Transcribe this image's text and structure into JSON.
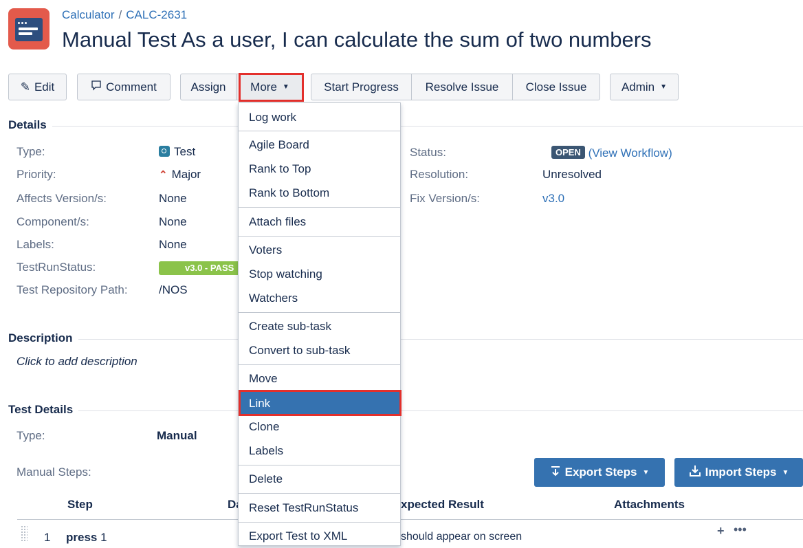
{
  "header": {
    "project": "Calculator",
    "separator": "/",
    "issue_key": "CALC-2631",
    "summary": "Manual Test As a user, I can calculate the sum of two numbers"
  },
  "toolbar": {
    "edit": "Edit",
    "comment": "Comment",
    "assign": "Assign",
    "more": "More",
    "start_progress": "Start Progress",
    "resolve_issue": "Resolve Issue",
    "close_issue": "Close Issue",
    "admin": "Admin"
  },
  "details": {
    "title": "Details",
    "type_label": "Type:",
    "type_value": "Test",
    "priority_label": "Priority:",
    "priority_value": "Major",
    "affects_label": "Affects Version/s:",
    "affects_value": "None",
    "component_label": "Component/s:",
    "component_value": "None",
    "labels_label": "Labels:",
    "labels_value": "None",
    "testrunstatus_label": "TestRunStatus:",
    "testrunstatus_value": "v3.0 - PASS",
    "repo_label": "Test Repository Path:",
    "repo_value": "/NOS",
    "status_label": "Status:",
    "status_value": "OPEN",
    "view_workflow": "(View Workflow)",
    "resolution_label": "Resolution:",
    "resolution_value": "Unresolved",
    "fix_label": "Fix Version/s:",
    "fix_value": "v3.0"
  },
  "description": {
    "title": "Description",
    "placeholder": "Click to add description"
  },
  "test_details": {
    "title": "Test Details",
    "type_label": "Type:",
    "type_value": "Manual",
    "steps_label": "Manual Steps:",
    "export_steps": "Export Steps",
    "import_steps": "Import Steps",
    "columns": {
      "step": "Step",
      "data": "Da",
      "expected": "xpected Result",
      "attachments": "Attachments"
    },
    "rows": [
      {
        "index": "1",
        "step_bold": "press",
        "step_rest": " 1",
        "expected": "should appear on screen"
      }
    ]
  },
  "more_menu": {
    "items": [
      "Log work",
      "Agile Board",
      "Rank to Top",
      "Rank to Bottom",
      "Attach files",
      "Voters",
      "Stop watching",
      "Watchers",
      "Create sub-task",
      "Convert to sub-task",
      "Move",
      "Link",
      "Clone",
      "Labels",
      "Delete",
      "Reset TestRunStatus",
      "Export Test to XML"
    ],
    "highlighted": "Link"
  },
  "colors": {
    "link": "#2d6fb6",
    "highlight_red": "#e3302c",
    "menu_active": "#3572b0",
    "status_lozenge": "#3b5673",
    "pass_green": "#8bc34a"
  },
  "icons": [
    "pencil-icon",
    "comment-icon",
    "caret-down-icon",
    "test-type-icon",
    "major-priority-icon",
    "export-icon",
    "import-icon",
    "plus-icon",
    "more-icon",
    "drag-handle-icon"
  ]
}
